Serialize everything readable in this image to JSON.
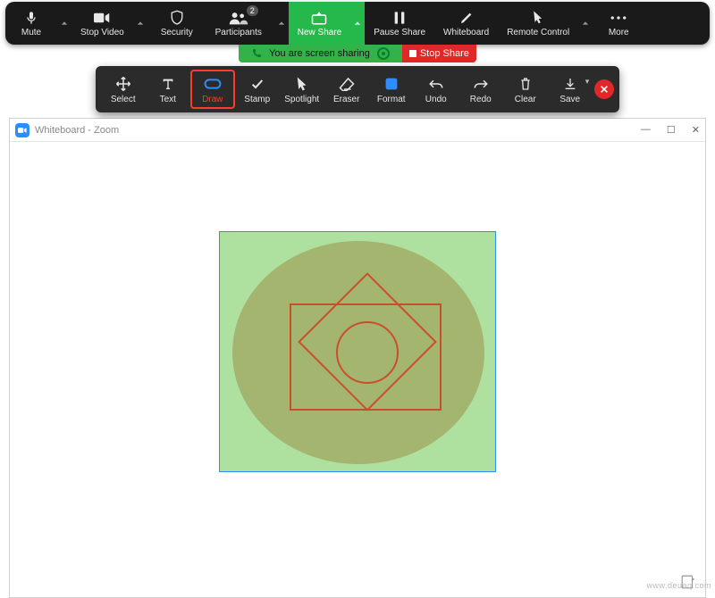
{
  "topbar": {
    "mute": {
      "label": "Mute"
    },
    "video": {
      "label": "Stop Video"
    },
    "security": {
      "label": "Security"
    },
    "participants": {
      "label": "Participants",
      "count": "2"
    },
    "newshare": {
      "label": "New Share"
    },
    "pauseshare": {
      "label": "Pause Share"
    },
    "whiteboard": {
      "label": "Whiteboard"
    },
    "remotecontrol": {
      "label": "Remote Control"
    },
    "more": {
      "label": "More"
    }
  },
  "status": {
    "sharing_text": "You are screen sharing",
    "stop_label": "Stop Share"
  },
  "annotate": {
    "select": "Select",
    "text": "Text",
    "draw": "Draw",
    "stamp": "Stamp",
    "spotlight": "Spotlight",
    "eraser": "Eraser",
    "format": "Format",
    "undo": "Undo",
    "redo": "Redo",
    "clear": "Clear",
    "save": "Save"
  },
  "window": {
    "title": "Whiteboard - Zoom"
  },
  "watermark": "www.deuaq.com"
}
